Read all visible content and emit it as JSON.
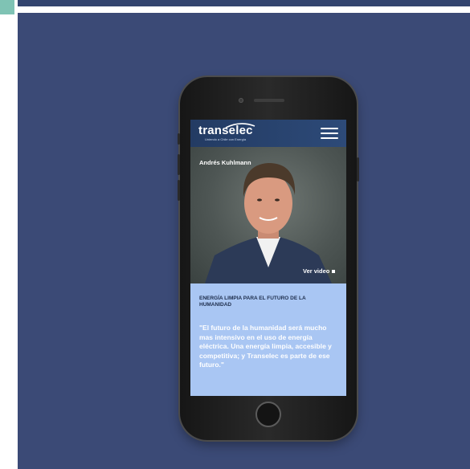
{
  "brand": {
    "logo": "transelec",
    "tagline": "Uniendo a Chile con Energía"
  },
  "hero": {
    "person_name": "Andrés Kuhlmann",
    "video_link": "Ver video"
  },
  "content": {
    "headline": "ENERGÍA LIMPIA PARA EL FUTURO DE LA HUMANIDAD",
    "quote": "\"El futuro de la humanidad será mucho mas intensivo en el uso de energía eléctrica. Una energía limpia, accesible y competitiva; y Transelec es parte de ese futuro.\""
  },
  "colors": {
    "stage": "#3b4a76",
    "accent_corner": "#7fc3b4",
    "screen_panel": "#a9c6f3",
    "header": "#233b63"
  }
}
